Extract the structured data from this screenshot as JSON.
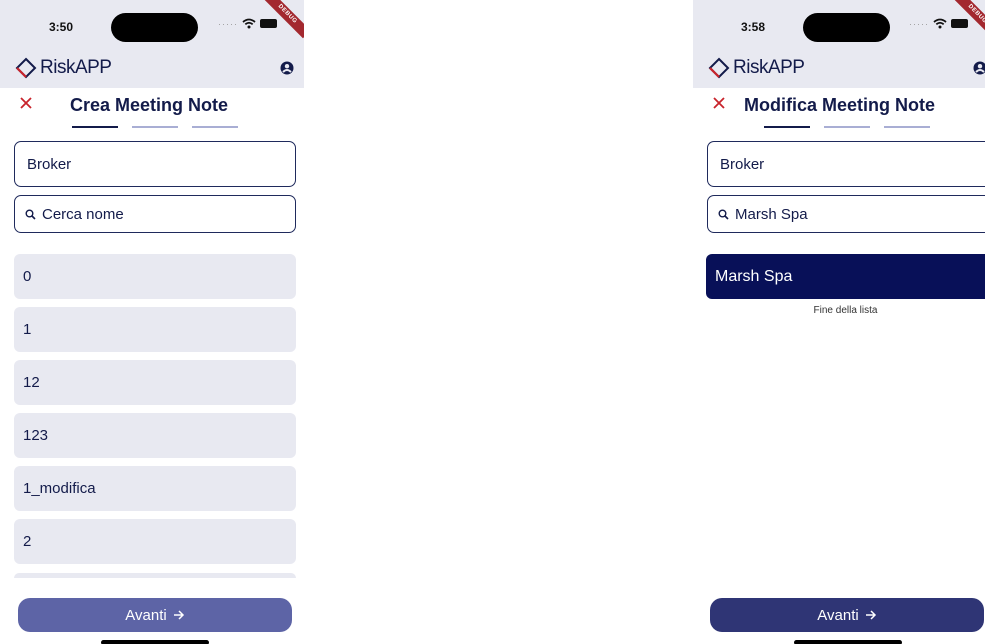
{
  "brand": {
    "name": "RiskAPP"
  },
  "debug_banner": "DEBUG",
  "colors": {
    "primary": "#131b4a",
    "selected": "#081058",
    "header_bg": "#e8e9f1",
    "close_red": "#c8232b",
    "button_disabled": "#5d64a6",
    "button_enabled": "#2f3575",
    "step_inactive": "#a9aed4"
  },
  "screens": [
    {
      "status_time": "3:50",
      "title": "Crea Meeting Note",
      "steps": {
        "total": 3,
        "current": 1
      },
      "category_field": {
        "value": "Broker"
      },
      "search": {
        "placeholder": "Cerca nome",
        "value": ""
      },
      "list_items": [
        "0",
        "1",
        "12",
        "123",
        "1_modifica",
        "2"
      ],
      "next_button": {
        "label": "Avanti",
        "icon": "arrow-right-icon",
        "enabled": false
      }
    },
    {
      "status_time": "3:58",
      "title": "Modifica Meeting Note",
      "steps": {
        "total": 3,
        "current": 1
      },
      "category_field": {
        "value": "Broker"
      },
      "search": {
        "placeholder": "Cerca nome",
        "value": "Marsh Spa"
      },
      "list_items": [
        "Marsh Spa"
      ],
      "selected_item": "Marsh Spa",
      "end_of_list_text": "Fine della lista",
      "next_button": {
        "label": "Avanti",
        "icon": "arrow-right-icon",
        "enabled": true
      }
    }
  ]
}
